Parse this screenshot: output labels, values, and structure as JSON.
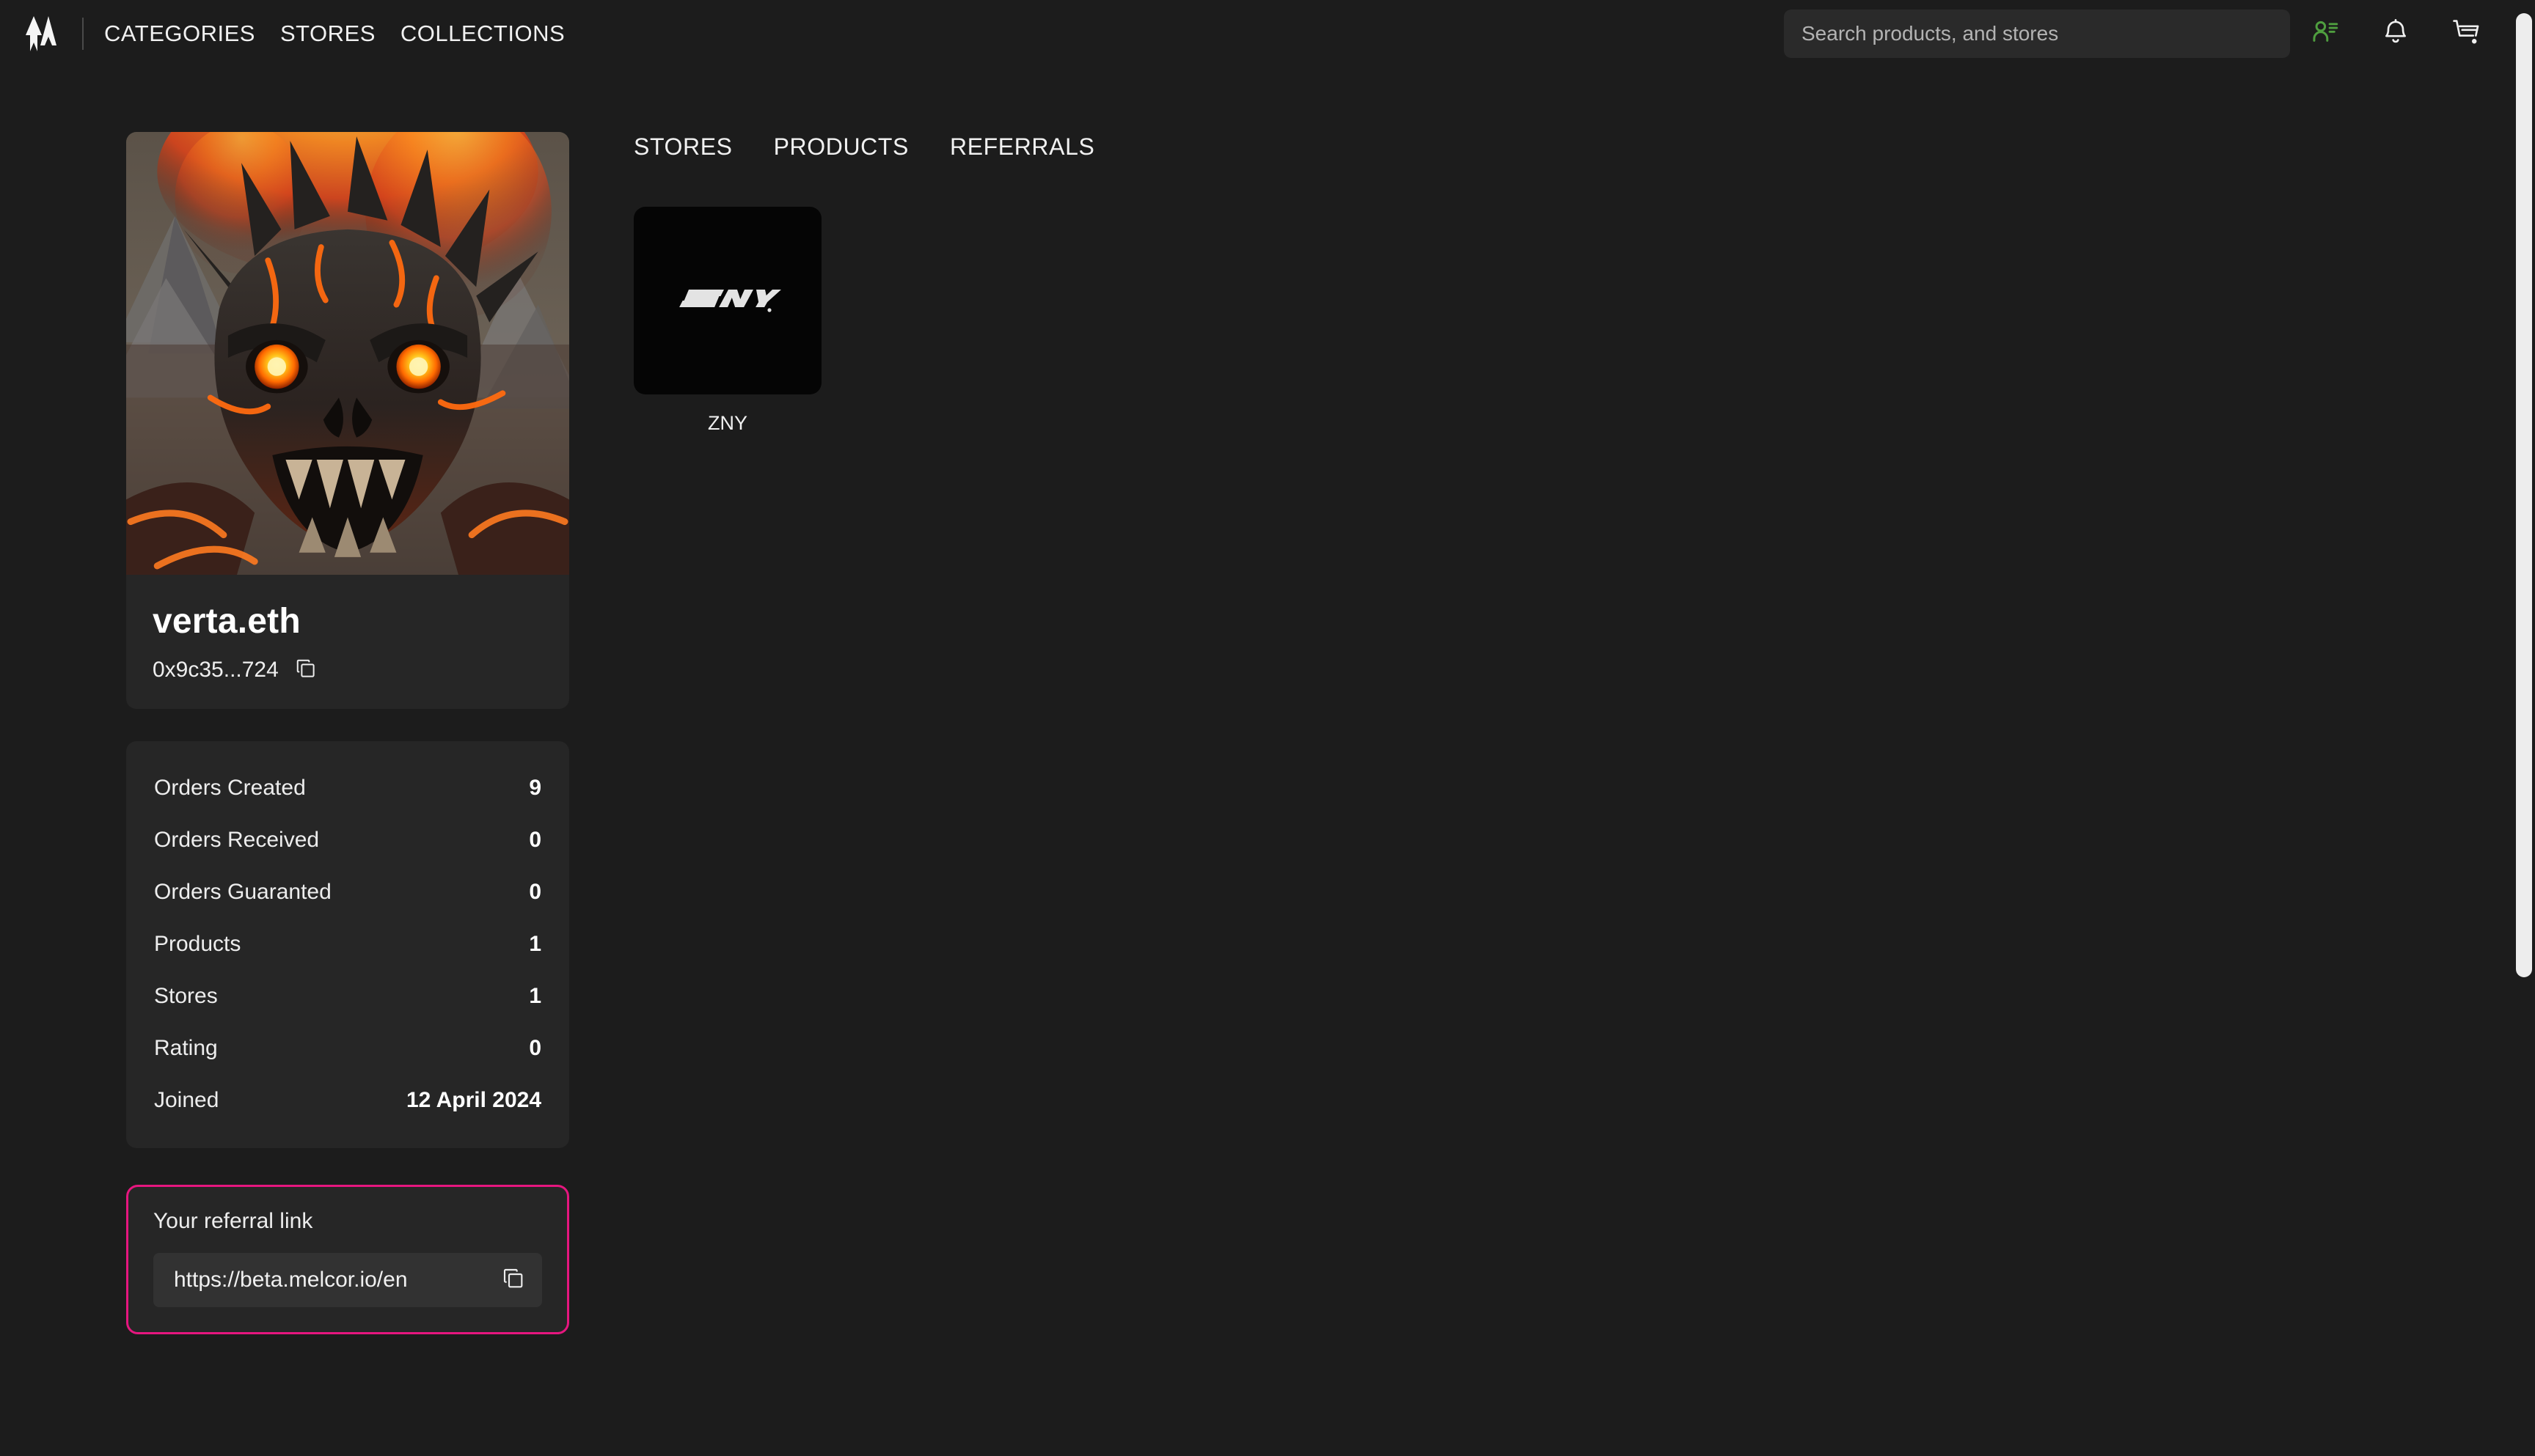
{
  "header": {
    "logo_icon": "melcor-m-logo",
    "nav": [
      {
        "label": "CATEGORIES"
      },
      {
        "label": "STORES"
      },
      {
        "label": "COLLECTIONS"
      }
    ],
    "search": {
      "placeholder": "Search products, and stores",
      "value": ""
    },
    "icons": [
      {
        "name": "account-icon",
        "color": "#4f9e3f"
      },
      {
        "name": "bell-icon",
        "color": "#ffffff"
      },
      {
        "name": "cart-icon",
        "color": "#ffffff"
      }
    ]
  },
  "profile": {
    "avatar_alt": "fiery lava demon skull artwork",
    "name": "verta.eth",
    "address": "0x9c35...724",
    "copy_icon": "copy-icon"
  },
  "stats": [
    {
      "label": "Orders Created",
      "value": "9"
    },
    {
      "label": "Orders Received",
      "value": "0"
    },
    {
      "label": "Orders Guaranted",
      "value": "0"
    },
    {
      "label": "Products",
      "value": "1"
    },
    {
      "label": "Stores",
      "value": "1"
    },
    {
      "label": "Rating",
      "value": "0"
    },
    {
      "label": "Joined",
      "value": "12 April 2024"
    }
  ],
  "referral": {
    "title": "Your referral link",
    "url": "https://beta.melcor.io/en",
    "copy_icon": "copy-icon",
    "border_color": "#e6167f"
  },
  "main": {
    "tabs": [
      {
        "label": "STORES"
      },
      {
        "label": "PRODUCTS"
      },
      {
        "label": "REFERRALS"
      }
    ],
    "stores": [
      {
        "name": "ZNY",
        "logo_text": "ZNY"
      }
    ]
  },
  "colors": {
    "page_bg": "#1c1c1c",
    "card_bg": "#262626",
    "accent_pink": "#e6167f",
    "accent_green": "#4f9e3f"
  }
}
